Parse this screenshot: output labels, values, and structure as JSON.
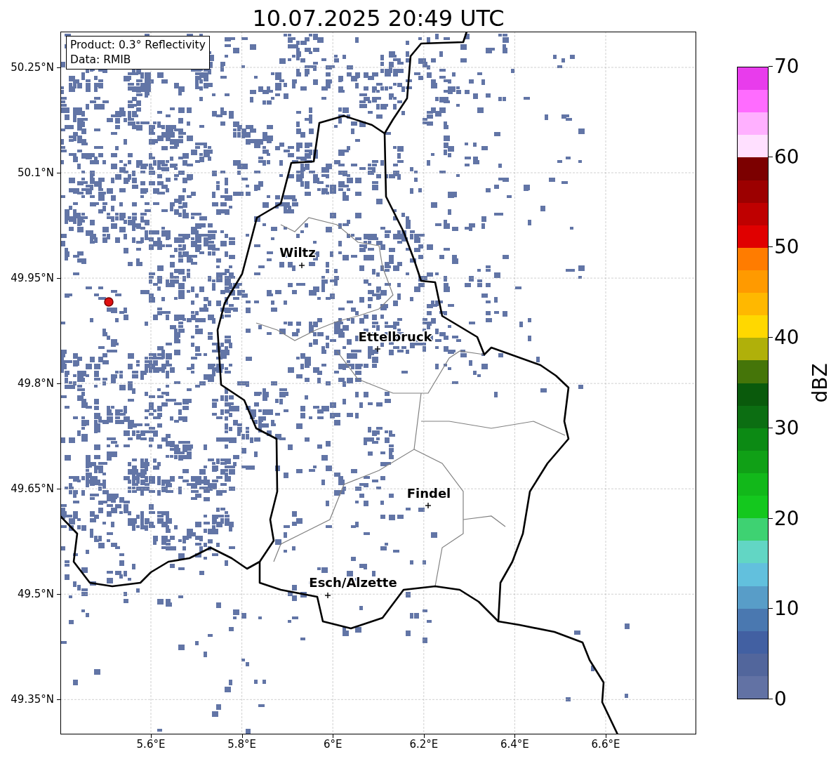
{
  "title": "10.07.2025 20:49 UTC",
  "map": {
    "info_box": [
      "Product: 0.3° Reflectivity",
      "Data: RMIB"
    ],
    "x_ticks": [
      "5.6°E",
      "5.8°E",
      "6°E",
      "6.2°E",
      "6.4°E",
      "6.6°E"
    ],
    "y_ticks": [
      "50.25°N",
      "50.1°N",
      "49.95°N",
      "49.8°N",
      "49.65°N",
      "49.5°N",
      "49.35°N"
    ],
    "places": [
      {
        "name": "Wiltz"
      },
      {
        "name": "Ettelbruck"
      },
      {
        "name": "Findel"
      },
      {
        "name": "Esch/Alzette"
      }
    ]
  },
  "colorbar": {
    "label": "dBZ",
    "ticks": [
      "70",
      "60",
      "50",
      "40",
      "30",
      "20",
      "10",
      "0"
    ],
    "segments": [
      {
        "color": "#e83cec"
      },
      {
        "color": "#ff6cff"
      },
      {
        "color": "#ffb0ff"
      },
      {
        "color": "#ffe0ff"
      },
      {
        "color": "#7c0000"
      },
      {
        "color": "#9c0000"
      },
      {
        "color": "#bf0000"
      },
      {
        "color": "#e00000"
      },
      {
        "color": "#ff7c00"
      },
      {
        "color": "#ff9a00"
      },
      {
        "color": "#ffb800"
      },
      {
        "color": "#ffd800"
      },
      {
        "color": "#b0b00a"
      },
      {
        "color": "#457509"
      },
      {
        "color": "#0a5a0c"
      },
      {
        "color": "#0c6e12"
      },
      {
        "color": "#0c8a14"
      },
      {
        "color": "#10a016"
      },
      {
        "color": "#12b81a"
      },
      {
        "color": "#14c81e"
      },
      {
        "color": "#3ed272"
      },
      {
        "color": "#62d6c4"
      },
      {
        "color": "#62c0dd"
      },
      {
        "color": "#589dc8"
      },
      {
        "color": "#4a78b0"
      },
      {
        "color": "#4260a2"
      },
      {
        "color": "#52669c"
      },
      {
        "color": "#6272a4"
      }
    ]
  }
}
